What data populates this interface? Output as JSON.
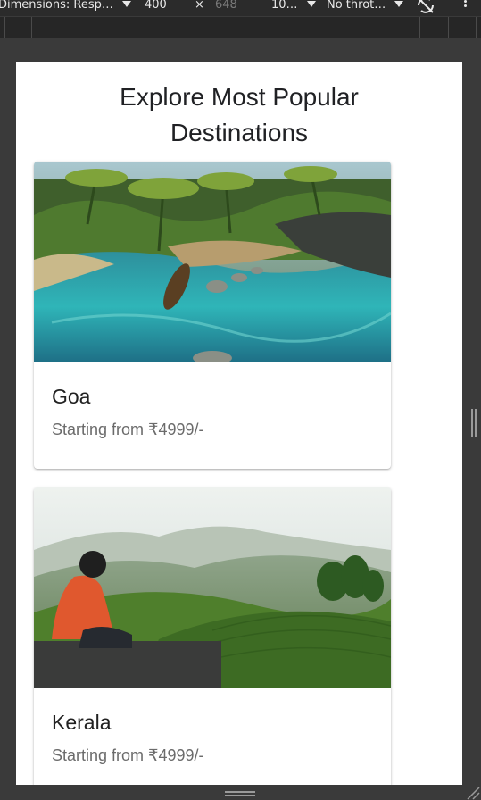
{
  "devtools": {
    "dimensions_label": "Dimensions: Resp…",
    "width_value": "400",
    "times_symbol": "×",
    "height_value": "648",
    "zoom_label": "10…",
    "throttle_label": "No throt…"
  },
  "page": {
    "title_line1": "Explore Most Popular",
    "title_line2": "Destinations"
  },
  "destinations": [
    {
      "name": "Goa",
      "price": "Starting from ₹4999/-"
    },
    {
      "name": "Kerala",
      "price": "Starting from ₹4999/-"
    }
  ],
  "colors": {
    "devtools_bg": "#2b2b2b",
    "viewport_bg": "#ffffff",
    "title_text": "#202124",
    "subtitle_text": "#6b6b6b"
  }
}
